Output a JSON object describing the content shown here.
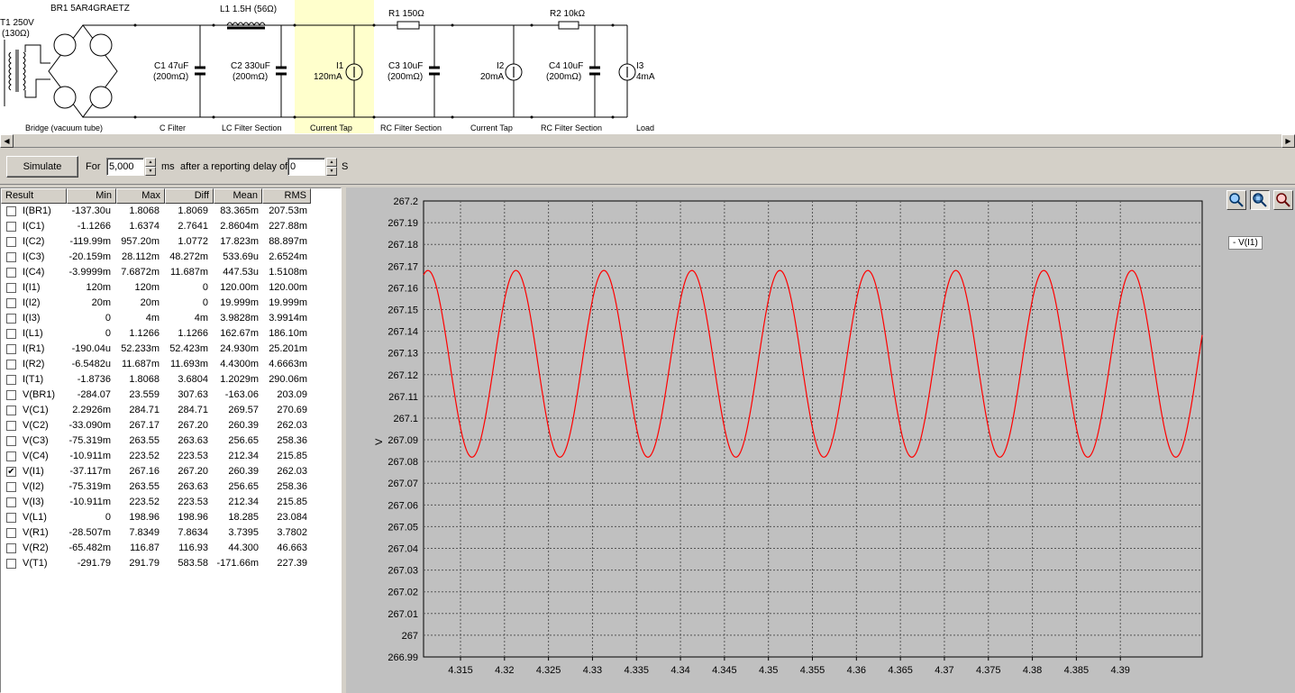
{
  "schematic": {
    "transformer": {
      "label": "T1 250V",
      "impedance": "(130Ω)"
    },
    "bridge": {
      "label": "BR1 5AR4GRAETZ",
      "section": "Bridge (vacuum tube)"
    },
    "c1": {
      "label": "C1 47uF",
      "esr": "(200mΩ)",
      "section": "C Filter"
    },
    "l1": {
      "label": "L1 1.5H (56Ω)"
    },
    "c2": {
      "label": "C2 330uF",
      "esr": "(200mΩ)",
      "section": "LC Filter Section"
    },
    "i1": {
      "label": "I1",
      "value": "120mA",
      "section": "Current Tap"
    },
    "r1": {
      "label": "R1 150Ω"
    },
    "c3": {
      "label": "C3 10uF",
      "esr": "(200mΩ)",
      "section": "RC Filter Section"
    },
    "i2": {
      "label": "I2",
      "value": "20mA",
      "section": "Current Tap"
    },
    "r2": {
      "label": "R2 10kΩ"
    },
    "c4": {
      "label": "C4 10uF",
      "esr": "(200mΩ)",
      "section": "RC Filter Section"
    },
    "i3": {
      "label": "I3",
      "value": "4mA",
      "section": "Load"
    },
    "highlight_color": "#ffffcc"
  },
  "toolbar": {
    "simulate_label": "Simulate",
    "for_label": "For",
    "duration_value": "5,000",
    "ms_label": "ms",
    "delay_label": "after a reporting delay of",
    "delay_value": "0",
    "s_label": "S"
  },
  "results": {
    "headers": [
      "Result",
      "Min",
      "Max",
      "Diff",
      "Mean",
      "RMS"
    ],
    "rows": [
      {
        "name": "I(BR1)",
        "min": "-137.30u",
        "max": "1.8068",
        "diff": "1.8069",
        "mean": "83.365m",
        "rms": "207.53m",
        "checked": false
      },
      {
        "name": "I(C1)",
        "min": "-1.1266",
        "max": "1.6374",
        "diff": "2.7641",
        "mean": "2.8604m",
        "rms": "227.88m",
        "checked": false
      },
      {
        "name": "I(C2)",
        "min": "-119.99m",
        "max": "957.20m",
        "diff": "1.0772",
        "mean": "17.823m",
        "rms": "88.897m",
        "checked": false
      },
      {
        "name": "I(C3)",
        "min": "-20.159m",
        "max": "28.112m",
        "diff": "48.272m",
        "mean": "533.69u",
        "rms": "2.6524m",
        "checked": false
      },
      {
        "name": "I(C4)",
        "min": "-3.9999m",
        "max": "7.6872m",
        "diff": "11.687m",
        "mean": "447.53u",
        "rms": "1.5108m",
        "checked": false
      },
      {
        "name": "I(I1)",
        "min": "120m",
        "max": "120m",
        "diff": "0",
        "mean": "120.00m",
        "rms": "120.00m",
        "checked": false
      },
      {
        "name": "I(I2)",
        "min": "20m",
        "max": "20m",
        "diff": "0",
        "mean": "19.999m",
        "rms": "19.999m",
        "checked": false
      },
      {
        "name": "I(I3)",
        "min": "0",
        "max": "4m",
        "diff": "4m",
        "mean": "3.9828m",
        "rms": "3.9914m",
        "checked": false
      },
      {
        "name": "I(L1)",
        "min": "0",
        "max": "1.1266",
        "diff": "1.1266",
        "mean": "162.67m",
        "rms": "186.10m",
        "checked": false
      },
      {
        "name": "I(R1)",
        "min": "-190.04u",
        "max": "52.233m",
        "diff": "52.423m",
        "mean": "24.930m",
        "rms": "25.201m",
        "checked": false
      },
      {
        "name": "I(R2)",
        "min": "-6.5482u",
        "max": "11.687m",
        "diff": "11.693m",
        "mean": "4.4300m",
        "rms": "4.6663m",
        "checked": false
      },
      {
        "name": "I(T1)",
        "min": "-1.8736",
        "max": "1.8068",
        "diff": "3.6804",
        "mean": "1.2029m",
        "rms": "290.06m",
        "checked": false
      },
      {
        "name": "V(BR1)",
        "min": "-284.07",
        "max": "23.559",
        "diff": "307.63",
        "mean": "-163.06",
        "rms": "203.09",
        "checked": false
      },
      {
        "name": "V(C1)",
        "min": "2.2926m",
        "max": "284.71",
        "diff": "284.71",
        "mean": "269.57",
        "rms": "270.69",
        "checked": false
      },
      {
        "name": "V(C2)",
        "min": "-33.090m",
        "max": "267.17",
        "diff": "267.20",
        "mean": "260.39",
        "rms": "262.03",
        "checked": false
      },
      {
        "name": "V(C3)",
        "min": "-75.319m",
        "max": "263.55",
        "diff": "263.63",
        "mean": "256.65",
        "rms": "258.36",
        "checked": false
      },
      {
        "name": "V(C4)",
        "min": "-10.911m",
        "max": "223.52",
        "diff": "223.53",
        "mean": "212.34",
        "rms": "215.85",
        "checked": false
      },
      {
        "name": "V(I1)",
        "min": "-37.117m",
        "max": "267.16",
        "diff": "267.20",
        "mean": "260.39",
        "rms": "262.03",
        "checked": true
      },
      {
        "name": "V(I2)",
        "min": "-75.319m",
        "max": "263.55",
        "diff": "263.63",
        "mean": "256.65",
        "rms": "258.36",
        "checked": false
      },
      {
        "name": "V(I3)",
        "min": "-10.911m",
        "max": "223.52",
        "diff": "223.53",
        "mean": "212.34",
        "rms": "215.85",
        "checked": false
      },
      {
        "name": "V(L1)",
        "min": "0",
        "max": "198.96",
        "diff": "198.96",
        "mean": "18.285",
        "rms": "23.084",
        "checked": false
      },
      {
        "name": "V(R1)",
        "min": "-28.507m",
        "max": "7.8349",
        "diff": "7.8634",
        "mean": "3.7395",
        "rms": "3.7802",
        "checked": false
      },
      {
        "name": "V(R2)",
        "min": "-65.482m",
        "max": "116.87",
        "diff": "116.93",
        "mean": "44.300",
        "rms": "46.663",
        "checked": false
      },
      {
        "name": "V(T1)",
        "min": "-291.79",
        "max": "291.79",
        "diff": "583.58",
        "mean": "-171.66m",
        "rms": "227.39",
        "checked": false
      }
    ]
  },
  "legend": {
    "label": "- V(I1)"
  },
  "icons": [
    "zoom-in-icon",
    "zoom-fit-icon",
    "zoom-out-icon",
    "scroll-left-icon",
    "scroll-right-icon"
  ],
  "chart_data": {
    "type": "line",
    "ylabel": "V",
    "xlabel": "",
    "xlim": [
      4.3108,
      4.3993
    ],
    "ylim": [
      266.99,
      267.2
    ],
    "x_ticks": [
      "4.315",
      "4.32",
      "4.325",
      "4.33",
      "4.335",
      "4.34",
      "4.345",
      "4.35",
      "4.355",
      "4.36",
      "4.365",
      "4.37",
      "4.375",
      "4.38",
      "4.385",
      "4.39"
    ],
    "y_ticks": [
      "267.2",
      "267.19",
      "267.18",
      "267.17",
      "267.16",
      "267.15",
      "267.14",
      "267.13",
      "267.12",
      "267.11",
      "267.1",
      "267.09",
      "267.08",
      "267.07",
      "267.06",
      "267.05",
      "267.04",
      "267.03",
      "267.02",
      "267.01",
      "267",
      "266.99"
    ],
    "grid": true,
    "background": "#c0c0c0",
    "series": [
      {
        "name": "V(I1)",
        "color": "#ff0000",
        "waveform": "sine",
        "max": 267.168,
        "min": 267.082,
        "period": 0.01,
        "first_peak_x": 4.3113
      }
    ]
  }
}
